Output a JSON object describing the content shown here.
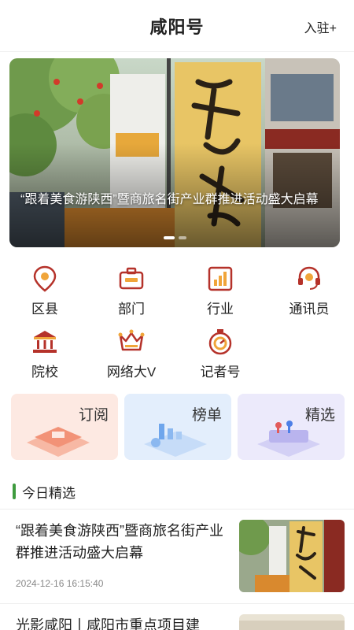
{
  "header": {
    "title": "咸阳号",
    "join_label": "入驻+"
  },
  "banner": {
    "caption": "“跟着美食游陕西”暨商旅名街产业群推进活动盛大启幕",
    "slide_count": 2,
    "active_slide": 1
  },
  "categories": [
    {
      "label": "区县",
      "icon": "location-pin-icon"
    },
    {
      "label": "部门",
      "icon": "briefcase-icon"
    },
    {
      "label": "行业",
      "icon": "bar-chart-icon"
    },
    {
      "label": "通讯员",
      "icon": "headset-icon"
    },
    {
      "label": "院校",
      "icon": "institution-icon"
    },
    {
      "label": "网络大V",
      "icon": "crown-icon"
    },
    {
      "label": "记者号",
      "icon": "stopwatch-icon"
    }
  ],
  "cards": [
    {
      "label": "订阅",
      "color": "#fde6df"
    },
    {
      "label": "榜单",
      "color": "#e1ecfb"
    },
    {
      "label": "精选",
      "color": "#ebe9fb"
    }
  ],
  "section": {
    "title": "今日精选",
    "accent": "#3e9b3e"
  },
  "news": [
    {
      "title": "“跟着美食游陕西”暨商旅名街产业群推进活动盛大启幕",
      "date": "2024-12-16 16:15:40"
    },
    {
      "title": "光影咸阳丨咸阳市重点项目建",
      "date": ""
    }
  ],
  "colors": {
    "icon_primary": "#b5322a",
    "icon_secondary": "#f0a53a"
  }
}
